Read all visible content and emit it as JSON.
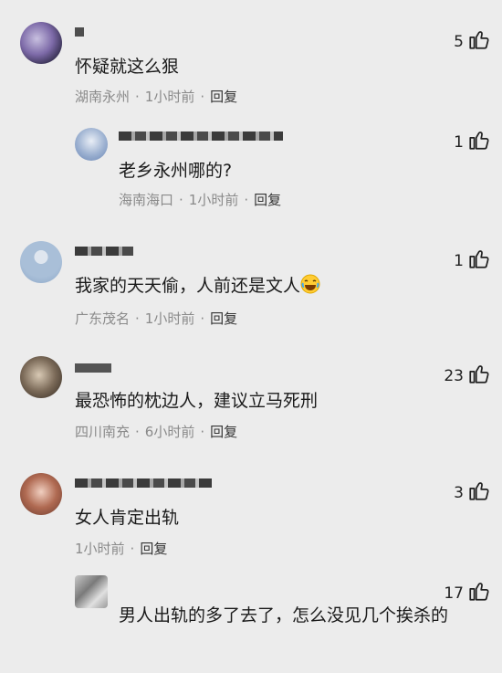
{
  "comments": [
    {
      "text": "怀疑就这么狠",
      "location": "湖南永州",
      "time": "1小时前",
      "reply": "回复",
      "likes": "5"
    },
    {
      "text": "老乡永州哪的?",
      "location": "海南海口",
      "time": "1小时前",
      "reply": "回复",
      "likes": "1"
    },
    {
      "text": "我家的天天偷，人前还是文人",
      "location": "广东茂名",
      "time": "1小时前",
      "reply": "回复",
      "likes": "1"
    },
    {
      "text": "最恐怖的枕边人，建议立马死刑",
      "location": "四川南充",
      "time": "6小时前",
      "reply": "回复",
      "likes": "23"
    },
    {
      "text": "女人肯定出轨",
      "time": "1小时前",
      "reply": "回复",
      "likes": "3"
    },
    {
      "text": "男人出轨的多了去了，怎么没见几个挨杀的",
      "likes": "17"
    }
  ],
  "icons": {
    "like": "thumbs-up-icon",
    "emoji": "laughing-tears-emoji-icon"
  }
}
